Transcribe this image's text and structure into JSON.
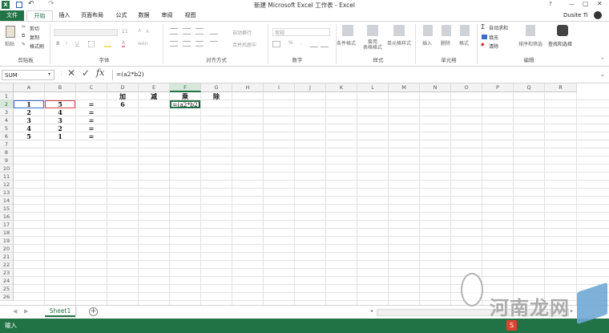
{
  "title": "新建 Microsoft Excel 工作表 - Excel",
  "user": "Dusite Ti",
  "quick_access": {
    "icons": [
      "excel-logo-icon",
      "save-icon",
      "undo-icon",
      "redo-icon"
    ]
  },
  "window_controls": {
    "help": "?",
    "minimize": "—",
    "restore": "▢",
    "close": "✕"
  },
  "tabs": [
    "文件",
    "开始",
    "插入",
    "页面布局",
    "公式",
    "数据",
    "审阅",
    "视图"
  ],
  "ribbon": {
    "clipboard": {
      "paste": "粘贴",
      "cut": "剪切",
      "copy": "复制",
      "format_painter": "格式刷",
      "label": "剪贴板"
    },
    "font": {
      "size": "11",
      "label": "字体",
      "bold": "B",
      "italic": "I",
      "underline": "U",
      "grow": "A",
      "shrink": "A",
      "color": "A",
      "phonetic": "wén"
    },
    "alignment": {
      "wrap": "自动换行",
      "merge": "合并后居中",
      "label": "对齐方式"
    },
    "number": {
      "format": "常规",
      "percent": "%",
      "comma": ",",
      "label": "数字"
    },
    "styles": {
      "conditional": "条件格式",
      "table": "套用\n表格格式",
      "cell_styles": "单元格样式",
      "label": "样式"
    },
    "cells": {
      "insert": "插入",
      "delete": "删除",
      "format": "格式",
      "label": "单元格"
    },
    "editing": {
      "autosum": "自动求和",
      "fill": "填充",
      "clear": "清除",
      "sort": "排序和筛选",
      "find": "查找和选择",
      "label": "编辑"
    }
  },
  "name_box": "SUM",
  "formula": "=(a2*b2)",
  "columns": [
    "A",
    "B",
    "C",
    "D",
    "E",
    "F",
    "G",
    "H",
    "I",
    "J",
    "K",
    "L",
    "M",
    "N",
    "O",
    "P",
    "Q",
    "R"
  ],
  "rows": [
    "1",
    "2",
    "3",
    "4",
    "5",
    "6",
    "7",
    "8",
    "9",
    "10",
    "11",
    "12",
    "13",
    "14",
    "15",
    "16",
    "17",
    "18",
    "19",
    "20",
    "21",
    "22",
    "23",
    "24",
    "25",
    "26"
  ],
  "cells": {
    "D1": "加",
    "E1": "减",
    "F1": "乘",
    "G1": "除",
    "A2": "1",
    "B2": "5",
    "C2": "=",
    "D2": "6",
    "F2": "=(a2*b2)",
    "A3": "2",
    "B3": "4",
    "C3": "=",
    "A4": "3",
    "B4": "3",
    "C4": "=",
    "A5": "4",
    "B5": "2",
    "C5": "=",
    "A6": "5",
    "B6": "1",
    "C6": "="
  },
  "sheet_tab": "Sheet1",
  "status": "输入",
  "watermark": "河南龙网",
  "colors": {
    "excel_green": "#217346",
    "selection": "#217346",
    "ref_blue": "#3a6cc8",
    "ref_red": "#e04040"
  }
}
